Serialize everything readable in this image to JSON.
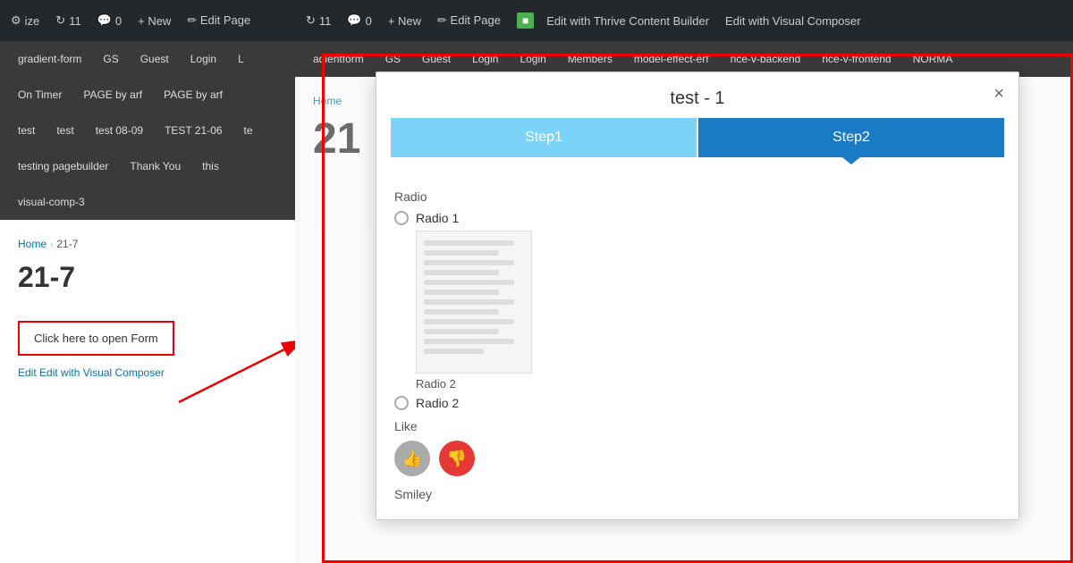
{
  "left_admin_bar": {
    "customize": "ize",
    "comments_count": "11",
    "comment_icon": "💬",
    "comments_zero": "0",
    "new_label": "+ New",
    "edit_label": "✏ Edit Page"
  },
  "left_nav_row1": {
    "items": [
      "gradient-form",
      "GS",
      "Guest",
      "Login",
      "L"
    ]
  },
  "left_nav_row2": {
    "items": [
      "On Timer",
      "PAGE by arf",
      "PAGE by arf"
    ]
  },
  "left_nav_row3": {
    "items": [
      "test",
      "test",
      "test 08-09",
      "TEST 21-06",
      "te"
    ]
  },
  "left_nav_row4": {
    "items": [
      "testing pagebuilder",
      "Thank You",
      "this"
    ]
  },
  "left_nav_row5": {
    "items": [
      "visual-comp-3"
    ]
  },
  "left_content": {
    "breadcrumb_home": "Home",
    "breadcrumb_sep": "›",
    "breadcrumb_current": "21-7",
    "page_title": "21-7",
    "open_form_text": "Click here to open Form",
    "edit_link1": "Edit",
    "edit_link2": "Edit with Visual Composer"
  },
  "right_admin_bar": {
    "comments_count": "11",
    "comments_zero": "0",
    "new_label": "+ New",
    "edit_label": "✏ Edit Page",
    "thrive_label": "Edit with Thrive Content Builder",
    "visual_composer_label": "Edit with Visual Composer"
  },
  "right_nav": {
    "items": [
      "adientform",
      "GS",
      "Guest",
      "Login",
      "Login",
      "Members",
      "model-effect-erf",
      "nce-v-backend",
      "nce-v-frontend",
      "NORMA"
    ]
  },
  "right_content_bg": {
    "breadcrumb": "Home",
    "title": "21"
  },
  "modal": {
    "title": "test - 1",
    "close_label": "×",
    "step1_label": "Step1",
    "step2_label": "Step2",
    "radio_field_label": "Radio",
    "radio1_label": "Radio 1",
    "radio2_image_caption": "Radio 2",
    "radio2_label": "Radio 2",
    "like_field_label": "Like",
    "smiley_label": "Smiley"
  }
}
